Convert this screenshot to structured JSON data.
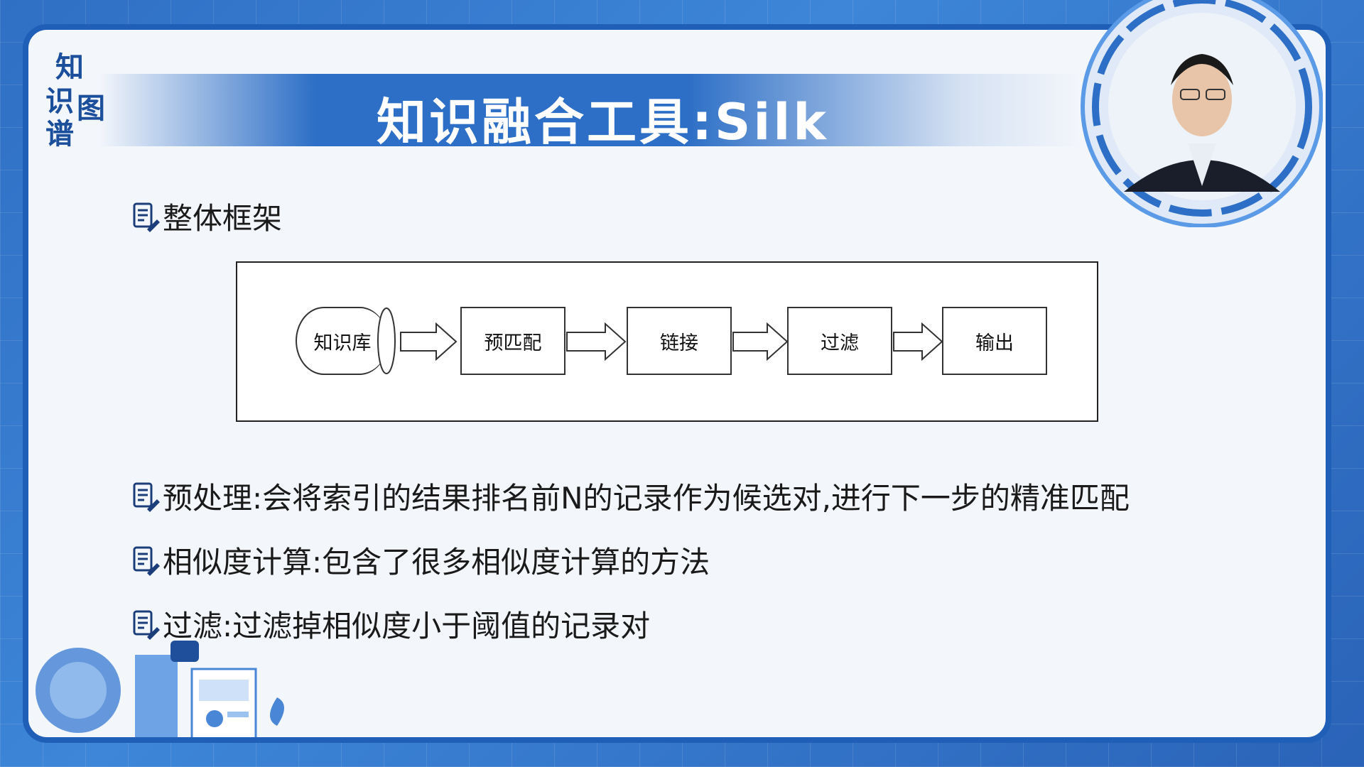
{
  "logo": {
    "chars": [
      "知",
      "识",
      "图",
      "谱"
    ]
  },
  "title": "知识融合工具:Silk",
  "sections": {
    "framework": "整体框架",
    "preprocess": "预处理:会将索引的结果排名前N的记录作为候选对,进行下一步的精准匹配",
    "similarity": "相似度计算:包含了很多相似度计算的方法",
    "filter": "过滤:过滤掉相似度小于阈值的记录对"
  },
  "diagram": {
    "nodes": [
      "知识库",
      "预匹配",
      "链接",
      "过滤",
      "输出"
    ]
  },
  "colors": {
    "brand": "#1f5fb8",
    "banner": "#2d6fc6",
    "slide_bg": "#f3f6fb"
  },
  "icons": {
    "bullet": "note-edit-icon",
    "presenter": "presenter-video"
  }
}
